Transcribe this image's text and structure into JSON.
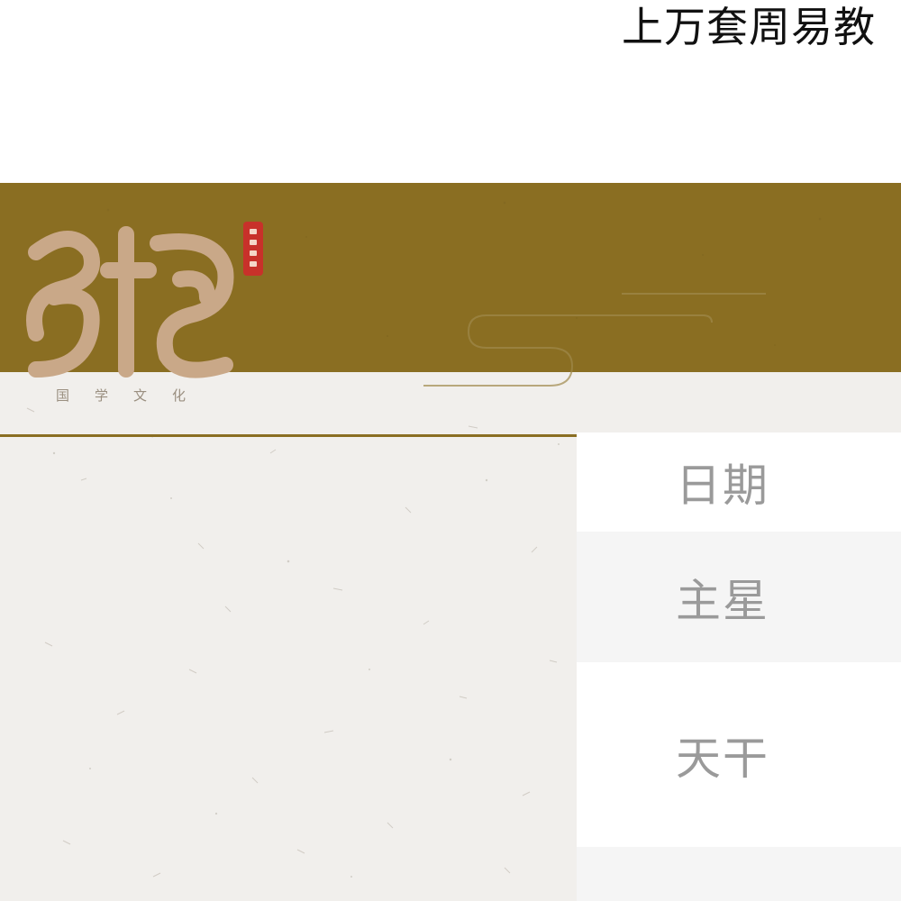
{
  "header": {
    "title": "上万套周易教"
  },
  "logo": {
    "brand": "易熵",
    "seal_text": "国学文化",
    "subtitle": "国学文化"
  },
  "menu": {
    "items": [
      {
        "label": "日期"
      },
      {
        "label": "主星"
      },
      {
        "label": "天干"
      },
      {
        "label": ""
      }
    ]
  },
  "colors": {
    "banner": "#8a6e22",
    "paper": "#f1efec",
    "seal": "#c8312a",
    "menu_text": "#9a9a9a",
    "logo_text": "#c9a888"
  }
}
